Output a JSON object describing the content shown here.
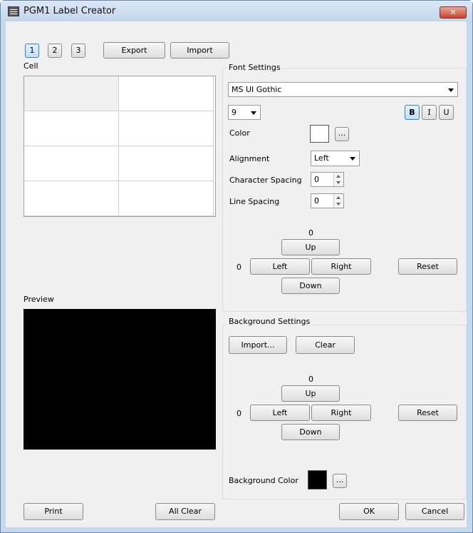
{
  "window": {
    "title": "PGM1 Label Creator",
    "close_glyph": "✕"
  },
  "pages": [
    "1",
    "2",
    "3"
  ],
  "top_buttons": {
    "export": "Export",
    "import": "Import"
  },
  "cell": {
    "label": "Cell"
  },
  "preview": {
    "label": "Preview"
  },
  "font_settings": {
    "title": "Font Settings",
    "font_name": "MS UI Gothic",
    "font_size": "9",
    "style_buttons": {
      "bold": "B",
      "italic": "I",
      "underline": "U"
    },
    "color_label": "Color",
    "color_value": "#ffffff",
    "browse": "...",
    "alignment_label": "Alignment",
    "alignment_value": "Left",
    "char_spacing_label": "Character Spacing",
    "char_spacing_value": "0",
    "line_spacing_label": "Line Spacing",
    "line_spacing_value": "0",
    "offset": {
      "vertical": "0",
      "horizontal": "0",
      "up": "Up",
      "left": "Left",
      "right": "Right",
      "down": "Down",
      "reset": "Reset"
    }
  },
  "background_settings": {
    "title": "Background Settings",
    "import": "Import...",
    "clear": "Clear",
    "offset": {
      "vertical": "0",
      "horizontal": "0",
      "up": "Up",
      "left": "Left",
      "right": "Right",
      "down": "Down",
      "reset": "Reset"
    },
    "bg_color_label": "Background Color",
    "bg_color_value": "#000000",
    "browse": "..."
  },
  "footer": {
    "print": "Print",
    "all_clear": "All Clear",
    "ok": "OK",
    "cancel": "Cancel"
  }
}
